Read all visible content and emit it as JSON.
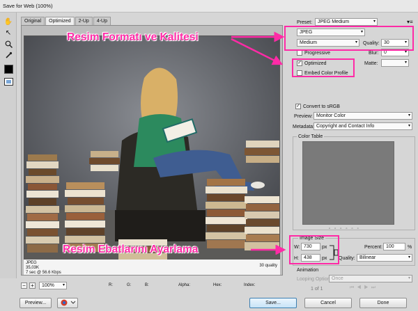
{
  "window": {
    "title": "Save for Web (100%)"
  },
  "tabs": [
    "Original",
    "Optimized",
    "2-Up",
    "4-Up"
  ],
  "image_info": {
    "format": "JPEG",
    "size": "35,03K",
    "time": "7 sec @ 56.6 Kbps",
    "quality": "30 quality"
  },
  "annotations": {
    "format": "Resim Formatı ve Kalitesi",
    "size": "Resim Ebatlarını Ayarlama"
  },
  "bottombar": {
    "zoom": "100%",
    "r": "R:",
    "g": "G:",
    "b": "B:",
    "alpha": "Alpha:",
    "hex": "Hex:",
    "index": "Index:"
  },
  "settings": {
    "preset_label": "Preset:",
    "preset_value": "JPEG Medium",
    "format": "JPEG",
    "compression": "Medium",
    "quality_label": "Quality:",
    "quality_value": "30",
    "progressive": "Progressive",
    "blur_label": "Blur:",
    "blur_value": "0",
    "optimized": "Optimized",
    "matte_label": "Matte:",
    "embed_profile": "Embed Color Profile",
    "convert_srgb": "Convert to sRGB",
    "preview_label": "Preview:",
    "preview_value": "Monitor Color",
    "metadata_label": "Metadata:",
    "metadata_value": "Copyright and Contact Info",
    "color_table": "Color Table"
  },
  "image_size": {
    "title": "Image Size",
    "w_label": "W:",
    "w_value": "730",
    "h_label": "H:",
    "h_value": "438",
    "unit": "px",
    "percent_label": "Percent:",
    "percent_value": "100",
    "percent_unit": "%",
    "quality_label": "Quality:",
    "quality_value": "Bilinear"
  },
  "animation": {
    "title": "Animation",
    "looping_label": "Looping Options:",
    "looping_value": "Once",
    "frame": "1 of 1"
  },
  "buttons": {
    "preview": "Preview...",
    "save": "Save...",
    "cancel": "Cancel",
    "done": "Done"
  }
}
